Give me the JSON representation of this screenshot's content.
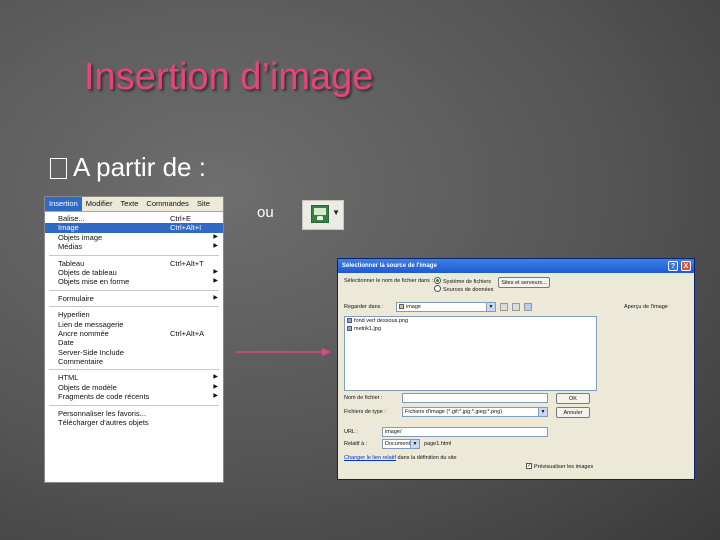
{
  "slide": {
    "title": "Insertion d’image",
    "bullet_symbol": " ",
    "bullet_text": "A  partir de :",
    "ou_label": "ou"
  },
  "menu": {
    "bar": [
      "Insertion",
      "Modifier",
      "Texte",
      "Commandes",
      "Site"
    ],
    "active_index": 0,
    "groups": [
      [
        {
          "label": "Balise...",
          "shortcut": "Ctrl+E"
        },
        {
          "label": "Image",
          "shortcut": "Ctrl+Alt+I",
          "selected": true
        },
        {
          "label": "Objets image",
          "submenu": true
        },
        {
          "label": "Médias",
          "submenu": true
        }
      ],
      [
        {
          "label": "Tableau",
          "shortcut": "Ctrl+Alt+T"
        },
        {
          "label": "Objets de tableau",
          "submenu": true
        },
        {
          "label": "Objets mise en forme",
          "submenu": true
        }
      ],
      [
        {
          "label": "Formulaire",
          "submenu": true
        }
      ],
      [
        {
          "label": "Hyperlien"
        },
        {
          "label": "Lien de messagerie"
        },
        {
          "label": "Ancre nommée",
          "shortcut": "Ctrl+Alt+A"
        },
        {
          "label": "Date"
        },
        {
          "label": "Server-Side Include"
        },
        {
          "label": "Commentaire"
        }
      ],
      [
        {
          "label": "HTML",
          "submenu": true
        },
        {
          "label": "Objets de modèle",
          "submenu": true
        },
        {
          "label": "Fragments de code récents",
          "submenu": true
        }
      ],
      [
        {
          "label": "Personnaliser les favoris..."
        },
        {
          "label": "Télécharger d'autres objets"
        }
      ]
    ]
  },
  "dialog": {
    "title": "Sélectionner la source de l'image",
    "help_symbol": "?",
    "close_symbol": "X",
    "select_from_label": "Sélectionner le nom de fichier dans :",
    "source_options": [
      "Système de fichiers",
      "Sources de données"
    ],
    "sites_button": "Sites et serveurs...",
    "look_in_label": "Regarder dans :",
    "look_in_value": "image",
    "preview_label": "Aperçu de l'image",
    "files": [
      "fond vert dessous.png",
      "metrik1.jpg"
    ],
    "filename_label": "Nom de fichier :",
    "filename_value": "",
    "ok_button": "OK",
    "filetype_label": "Fichiers de type :",
    "filetype_value": "Fichiers d'image (*.gif;*.jpg;*.jpeg;*.png)",
    "cancel_button": "Annuler",
    "url_label": "URL :",
    "url_value": "image/",
    "relative_label": "Relatif à :",
    "relative_value": "Document",
    "relative_file": "page1.html",
    "change_default_link": "Changer le lien relatif",
    "change_default_suffix": "dans la définition du site",
    "preview_checkbox_label": "Prévisualiser les images",
    "preview_checked": true
  },
  "colors": {
    "title": "#e8437e",
    "arrow": "#d64a8c",
    "selection": "#316ac5"
  }
}
